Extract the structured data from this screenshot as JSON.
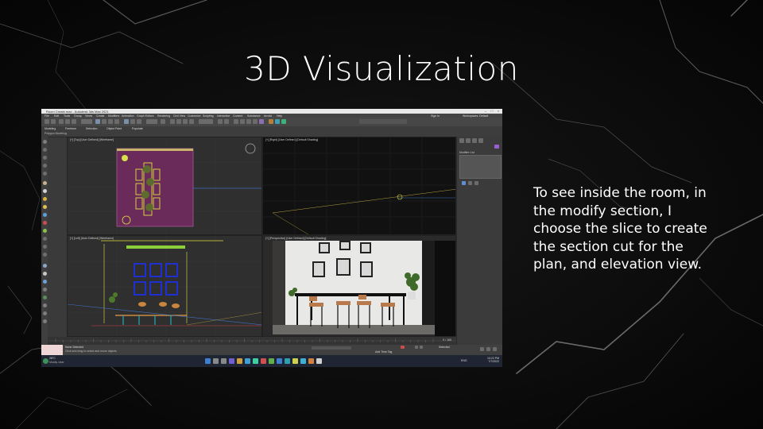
{
  "slide": {
    "title": "3D Visualization",
    "caption_lines": [
      "To see inside the room, in",
      "the modify section, I",
      "choose the slice to create",
      "the section cut for the",
      "plan, and elevation view."
    ]
  },
  "app": {
    "window_title": "Room Create.max - Autodesk 3ds Max 2021",
    "menu_items": [
      "File",
      "Edit",
      "Tools",
      "Group",
      "Views",
      "Create",
      "Modifiers",
      "Animation",
      "Graph Editors",
      "Rendering",
      "Civil View",
      "Customize",
      "Scripting",
      "Interactive",
      "Content",
      "Substance",
      "Arnold",
      "Help"
    ],
    "ribbon_tabs": [
      "Modeling",
      "Freeform",
      "Selection",
      "Object Paint",
      "Populate"
    ],
    "ribbon_sub": "Polygon Modeling",
    "search_label": "Sign In",
    "workspace_label": "Workspaces: Default",
    "viewports": {
      "top": "[+] [Top] [User Defined] [Wireframe]",
      "right": "[+] [Right] [User Defined] [Default Shading]",
      "front": "[+] [Left] [User Defined] [Wireframe]",
      "perspective": "[+] [Perspective] [User Defined] [Default Shading]"
    },
    "command_panel": {
      "modifier_list": "Modifier List"
    },
    "status": {
      "selection": "None Selected",
      "prompt": "Click and drag to select and move objects",
      "add_time_tag": "Add Time Tag",
      "selected": "Selected",
      "frame": "0 / 100"
    },
    "taskbar": {
      "weather_temp": "28°C",
      "weather_desc": "Mostly clear",
      "lang": "ENG",
      "time": "10:22 PM",
      "date": "7/7/2022"
    }
  }
}
